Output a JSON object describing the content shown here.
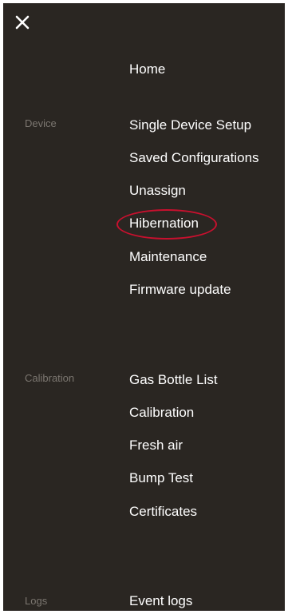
{
  "colors": {
    "background": "#2a2622",
    "text": "#ffffff",
    "muted": "#7b7670",
    "highlight": "#c8102e"
  },
  "header": {
    "close_icon": "close-icon"
  },
  "menu": {
    "home": "Home",
    "device": {
      "label": "Device",
      "items": [
        "Single Device Setup",
        "Saved Configurations",
        "Unassign",
        "Hibernation",
        "Maintenance",
        "Firmware update"
      ]
    },
    "calibration": {
      "label": "Calibration",
      "items": [
        "Gas Bottle List",
        "Calibration",
        "Fresh air",
        "Bump Test",
        "Certificates"
      ]
    },
    "logs": {
      "label": "Logs",
      "items": [
        "Event logs"
      ]
    }
  }
}
